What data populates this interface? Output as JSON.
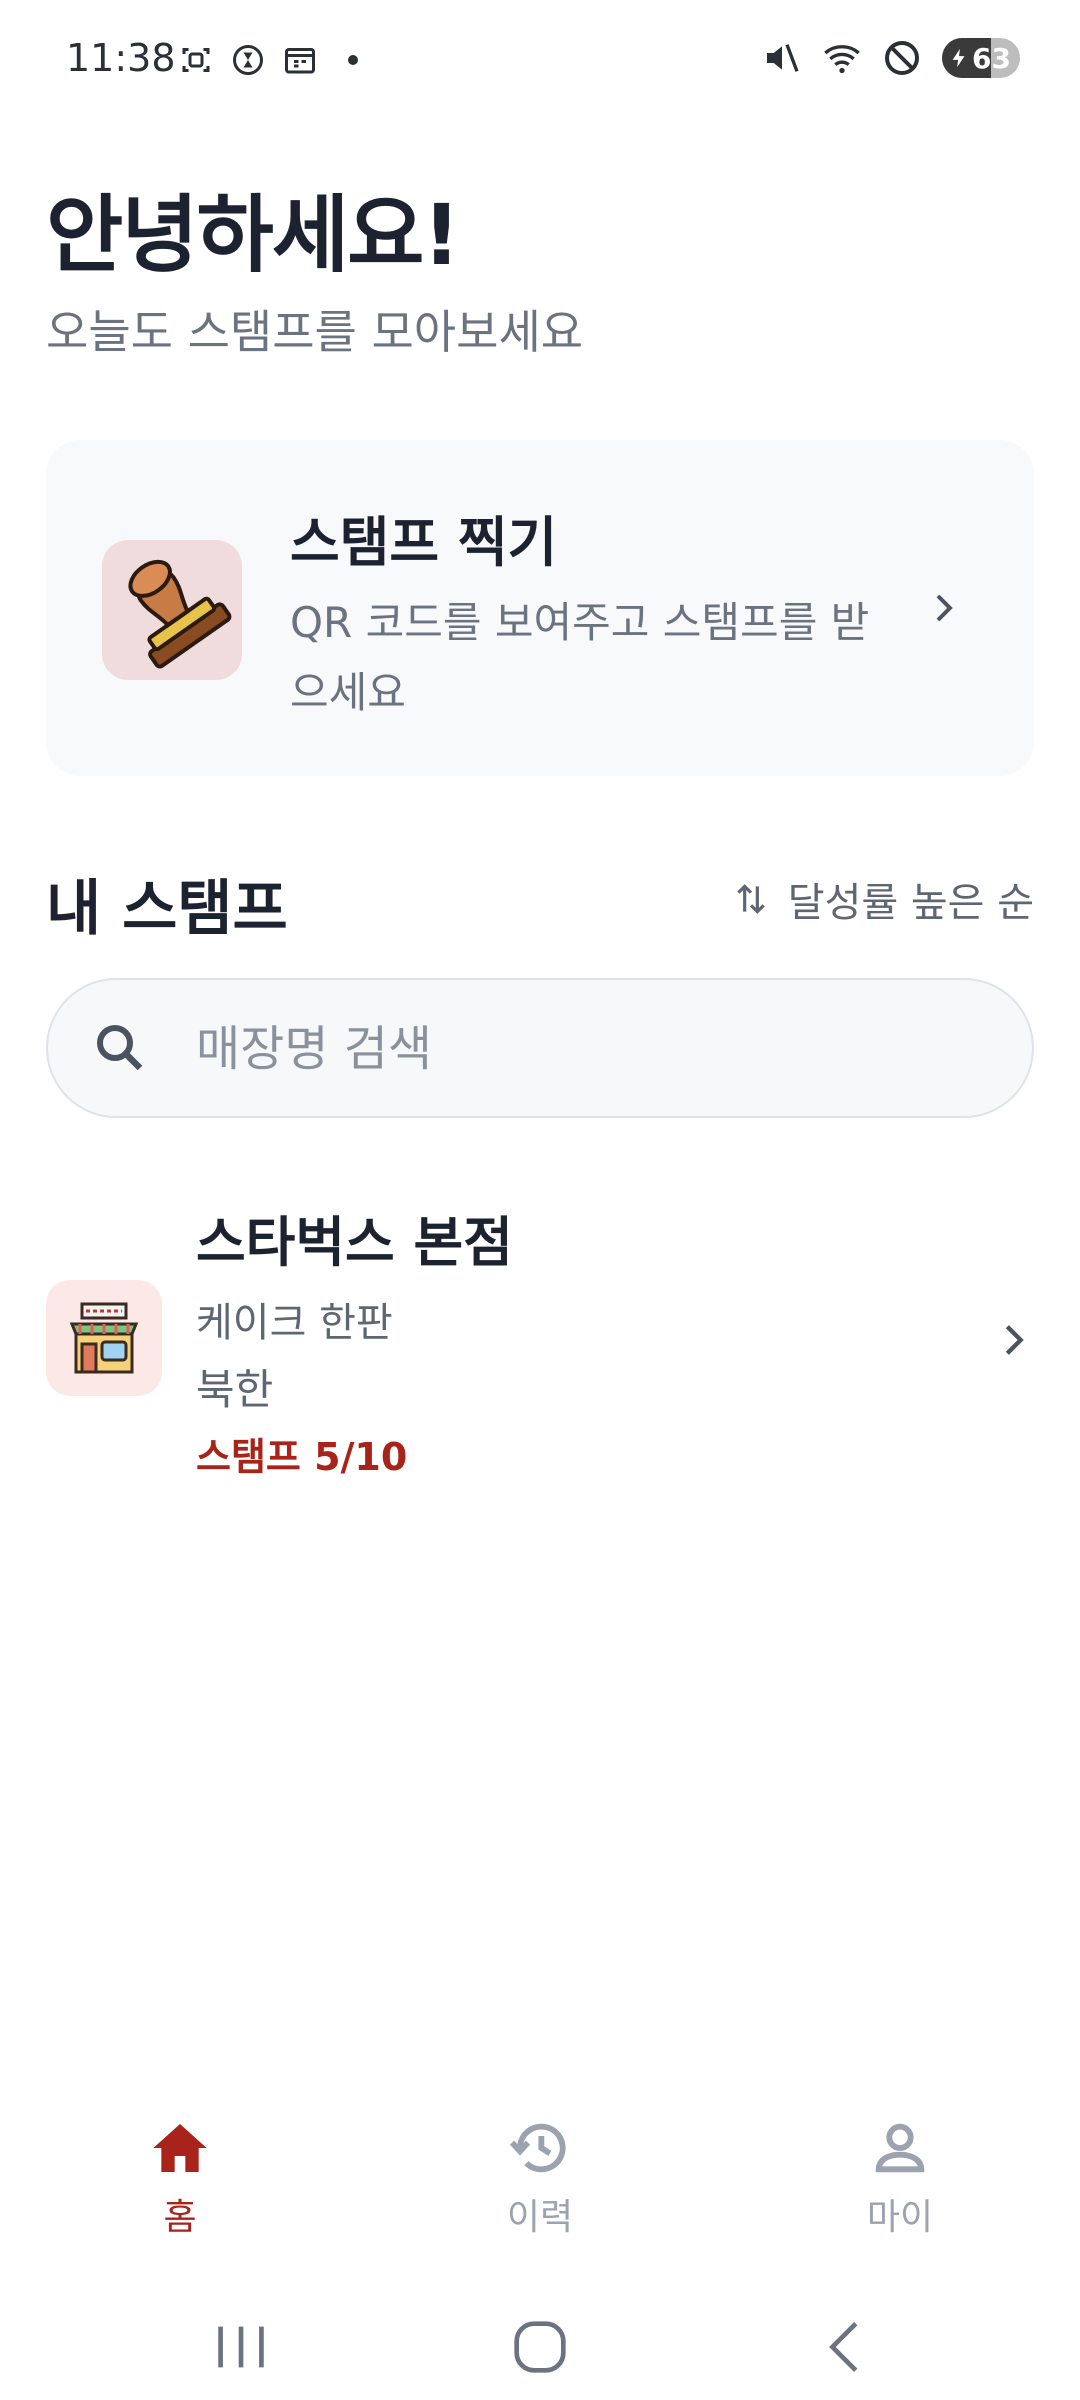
{
  "status_bar": {
    "time": "11:38",
    "battery_level": "63",
    "left_icons": [
      "screenshot-icon",
      "hourglass-icon",
      "calendar-icon",
      "notification-dot"
    ],
    "right_icons": [
      "mute-icon",
      "wifi-icon",
      "do-not-disturb-icon",
      "battery-charging-icon"
    ]
  },
  "greeting": {
    "title": "안녕하세요!",
    "subtitle": "오늘도 스탬프를 모아보세요"
  },
  "stamp_card": {
    "title": "스탬프 찍기",
    "description": "QR 코드를 보여주고 스탬프를 받으세요",
    "icon": "rubber-stamp-icon"
  },
  "my_stamps": {
    "title": "내 스탬프",
    "sort_label": "달성률 높은 순",
    "search_placeholder": "매장명 검색",
    "stores": [
      {
        "name": "스타벅스 본점",
        "reward": "케이크 한판",
        "owner": "북한",
        "progress_text": "스탬프 5/10",
        "stamps_collected": 5,
        "stamps_required": 10,
        "icon": "store-icon"
      }
    ]
  },
  "bottom_nav": {
    "items": [
      {
        "label": "홈",
        "icon": "home-icon",
        "active": true
      },
      {
        "label": "이력",
        "icon": "history-icon",
        "active": false
      },
      {
        "label": "마이",
        "icon": "person-icon",
        "active": false
      }
    ]
  },
  "colors": {
    "accent": "#a82319",
    "inactive": "#9ca3af",
    "card_bg": "#f7f9fb"
  }
}
